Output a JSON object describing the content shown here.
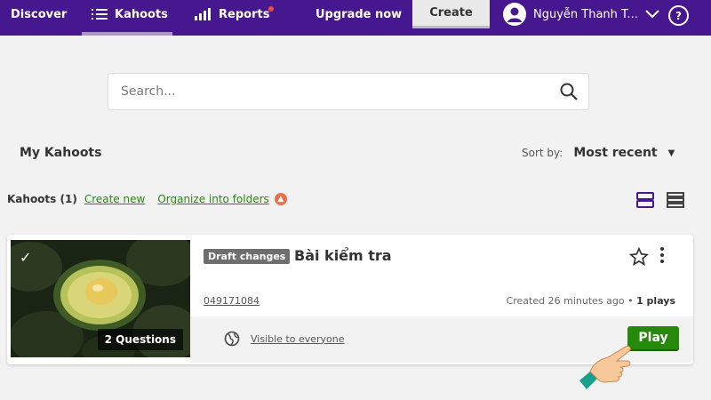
{
  "nav": {
    "discover": "Discover",
    "kahoots": "Kahoots",
    "reports": "Reports",
    "upgrade": "Upgrade now",
    "create": "Create",
    "user_name": "Nguyễn Thanh T...",
    "help": "?"
  },
  "search": {
    "placeholder": "Search..."
  },
  "section": {
    "title": "My Kahoots"
  },
  "sort": {
    "label": "Sort by:",
    "value": "Most recent"
  },
  "toolbar": {
    "count": "Kahoots (1)",
    "create_new": "Create new",
    "organize": "Organize into folders"
  },
  "kahoot": {
    "questions": "2 Questions",
    "draft_badge": "Draft changes",
    "title": "Bài kiểm tra",
    "pin": "049171084",
    "created": "Created 26 minutes ago",
    "plays": "1 plays",
    "visibility": "Visible to everyone",
    "play_label": "Play"
  },
  "colors": {
    "brand": "#46178f",
    "accent_green": "#26890c",
    "background": "#f2f2f2"
  }
}
